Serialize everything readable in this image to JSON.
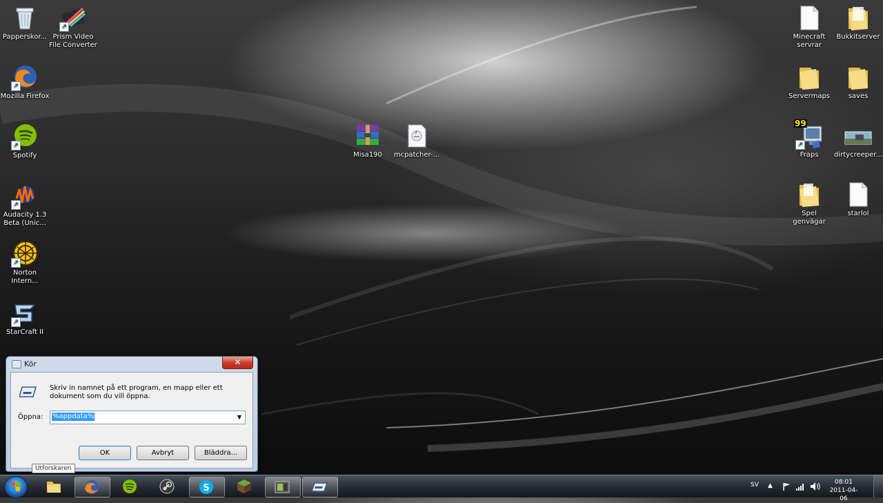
{
  "desktop": {
    "left_icons": [
      {
        "label": "Papperskor...",
        "icon": "recycle-bin-icon"
      },
      {
        "label": "Prism Video\nFile Converter",
        "icon": "prism-video-icon"
      },
      {
        "label": "Mozilla Firefox",
        "icon": "firefox-icon"
      },
      {
        "label": "Spotify",
        "icon": "spotify-icon"
      },
      {
        "label": "Audacity 1.3\nBeta (Unic...",
        "icon": "audacity-icon"
      },
      {
        "label": "Norton\nIntern...",
        "icon": "norton-icon"
      },
      {
        "label": "StarCraft II",
        "icon": "starcraft-icon"
      }
    ],
    "center_icons": [
      {
        "label": "Misa190",
        "icon": "winrar-archive-icon"
      },
      {
        "label": "mcpatcher-...",
        "icon": "java-file-icon"
      }
    ],
    "right_icons": [
      {
        "label": "Minecraft\nservrar",
        "icon": "document-icon"
      },
      {
        "label": "Bukkitserver",
        "icon": "folder-icon"
      },
      {
        "label": "Servermaps",
        "icon": "folder-icon"
      },
      {
        "label": "saves",
        "icon": "folder-icon"
      },
      {
        "label": "Fraps",
        "icon": "fraps-icon",
        "badge": "99"
      },
      {
        "label": "dirtycreeper...",
        "icon": "image-file-icon"
      },
      {
        "label": "Spel genvägar",
        "icon": "folder-icon"
      },
      {
        "label": "starlol",
        "icon": "document-icon"
      }
    ]
  },
  "run_dialog": {
    "title": "Kör",
    "close_glyph": "✕",
    "prompt": "Skriv in namnet på ett program, en mapp eller ett dokument som du vill öppna.",
    "open_label": "Öppna:",
    "open_value": "%appdata%",
    "buttons": {
      "ok": "OK",
      "cancel": "Avbryt",
      "browse": "Bläddra..."
    }
  },
  "tooltip": "Utforskaren",
  "taskbar": {
    "apps": [
      {
        "name": "Utforskaren",
        "icon": "explorer-folder-icon"
      },
      {
        "name": "Firefox",
        "icon": "firefox-icon"
      },
      {
        "name": "Spotify",
        "icon": "spotify-icon"
      },
      {
        "name": "Steam",
        "icon": "steam-icon"
      },
      {
        "name": "Skype",
        "icon": "skype-icon"
      },
      {
        "name": "Minecraft",
        "icon": "minecraft-icon"
      },
      {
        "name": "Minecraft server",
        "icon": "server-app-icon"
      },
      {
        "name": "Kör",
        "icon": "run-icon"
      }
    ],
    "language": "SV",
    "time": "08:01",
    "date": "2011-04-06"
  },
  "colors": {
    "selection": "#3399ff",
    "taskbar": "#2a3038",
    "folder": "#f3d26d"
  }
}
